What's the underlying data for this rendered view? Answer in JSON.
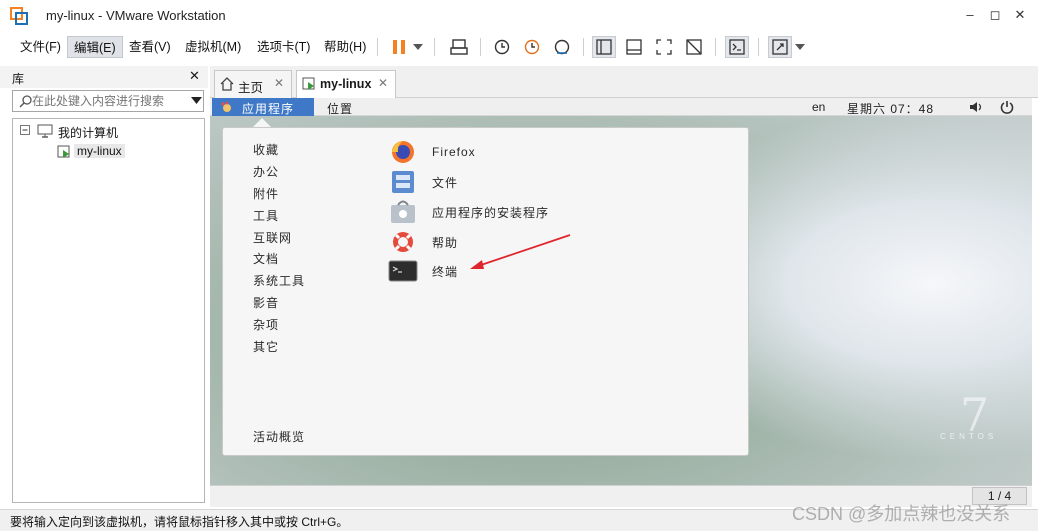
{
  "window": {
    "title": "my-linux - VMware Workstation"
  },
  "menubar": {
    "items": [
      "文件(F)",
      "编辑(E)",
      "查看(V)",
      "虚拟机(M)",
      "选项卡(T)",
      "帮助(H)"
    ],
    "active_index": 1
  },
  "toolbar": {
    "icons": [
      "pause-icon",
      "dropdown-icon",
      "send-ctrl-alt-del-icon",
      "snapshot-icon",
      "revert-snapshot-icon",
      "snapshot-manager-icon",
      "library-view-icon",
      "thumbnail-view-icon",
      "fullscreen-icon",
      "unity-icon",
      "console-icon",
      "stretch-icon",
      "dropdown-icon"
    ],
    "accent": "#f58220"
  },
  "library": {
    "title": "库",
    "search_placeholder": "在此处键入内容进行搜索",
    "tree": {
      "root": "我的计算机",
      "vm": "my-linux"
    }
  },
  "tabs": [
    {
      "label": "主页",
      "active": false
    },
    {
      "label": "my-linux",
      "active": true
    }
  ],
  "guest": {
    "topbar": {
      "apps": "应用程序",
      "places": "位置",
      "lang": "en",
      "clock": "星期六 07：48"
    },
    "categories": [
      "收藏",
      "办公",
      "附件",
      "工具",
      "互联网",
      "文档",
      "系统工具",
      "影音",
      "杂项",
      "其它"
    ],
    "activities": "活动概览",
    "apps": [
      {
        "name": "Firefox",
        "icon": "firefox-icon"
      },
      {
        "name": "文件",
        "icon": "files-icon"
      },
      {
        "name": "应用程序的安装程序",
        "icon": "software-installer-icon"
      },
      {
        "name": "帮助",
        "icon": "help-lifebuoy-icon"
      },
      {
        "name": "终端",
        "icon": "terminal-icon"
      }
    ],
    "brand": {
      "number": "7",
      "text": "CENTOS"
    },
    "accent": "#3f78c6"
  },
  "pager": {
    "label": "1 / 4"
  },
  "statusbar": {
    "text": "要将输入定向到该虚拟机，请将鼠标指针移入其中或按 Ctrl+G。"
  },
  "watermark": "CSDN @多加点辣也没关系"
}
